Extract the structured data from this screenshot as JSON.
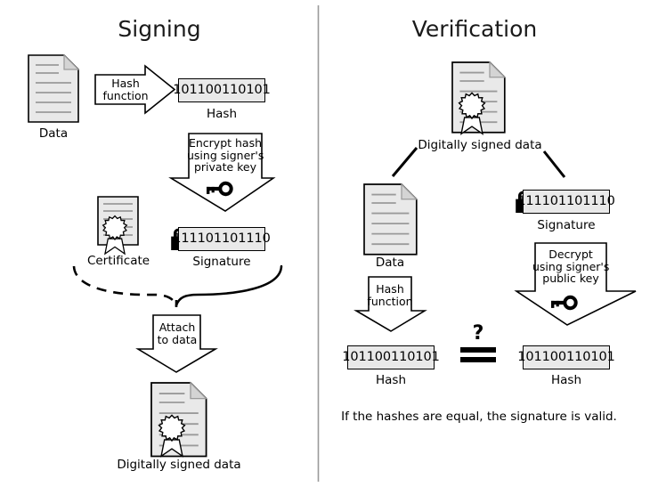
{
  "diagram": {
    "title_left": "Signing",
    "title_right": "Verification",
    "divider": "vertical-divider"
  },
  "colors": {
    "paper_fill": "#e9e9e9",
    "paper_stroke": "#000000",
    "rule_line": "#999999",
    "fold_fill": "#d8d8d8",
    "arrow_fill": "#ffffff",
    "arrow_stroke": "#000000",
    "divider": "#999999",
    "text": "#000000"
  },
  "signing": {
    "data_doc": {
      "icon": "document-icon",
      "caption": "Data"
    },
    "hash_function_arrow": {
      "icon": "right-arrow",
      "line1": "Hash",
      "line2": "function"
    },
    "hash_box": {
      "value": "101100110101",
      "caption": "Hash"
    },
    "encrypt_arrow": {
      "icon": "down-arrow",
      "line1": "Encrypt hash",
      "line2": "using signer's",
      "line3": "private key",
      "key_icon": "key-icon"
    },
    "certificate": {
      "icon": "certificate-icon",
      "caption": "Certificate"
    },
    "signature_box": {
      "value": "111101101110",
      "caption": "Signature",
      "lock_icon": "lock-icon"
    },
    "attach_arrow": {
      "icon": "down-arrow",
      "line1": "Attach",
      "line2": "to data"
    },
    "signed_doc": {
      "icon": "signed-document-icon",
      "caption": "Digitally signed data"
    },
    "connector_dashed": "dashed-curve-connector",
    "connector_solid": "solid-curve-connector"
  },
  "verification": {
    "signed_doc": {
      "icon": "signed-document-icon",
      "caption": "Digitally signed data"
    },
    "split_left": "diagonal-connector-left",
    "split_right": "diagonal-connector-right",
    "data_doc": {
      "icon": "document-icon",
      "caption": "Data"
    },
    "signature_box": {
      "value": "111101101110",
      "caption": "Signature",
      "lock_icon": "lock-icon"
    },
    "hash_function_arrow": {
      "icon": "down-arrow",
      "line1": "Hash",
      "line2": "function"
    },
    "decrypt_arrow": {
      "icon": "down-arrow",
      "line1": "Decrypt",
      "line2": "using signer's",
      "line3": "public key",
      "key_icon": "key-icon"
    },
    "hash_box_left": {
      "value": "101100110101",
      "caption": "Hash"
    },
    "hash_box_right": {
      "value": "101100110101",
      "caption": "Hash"
    },
    "comparison": {
      "question": "?",
      "operator": "equals-sign"
    },
    "conclusion": "If the hashes are equal, the signature is valid."
  }
}
